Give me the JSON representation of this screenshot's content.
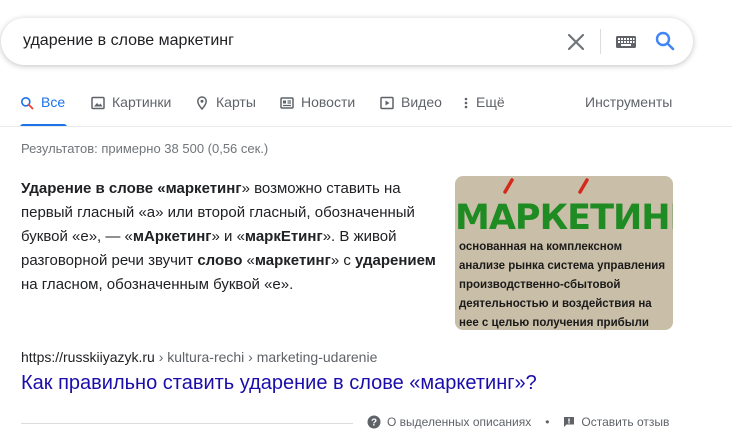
{
  "search": {
    "query": "ударение в слове маркетинг"
  },
  "tabs": [
    {
      "label": "Все",
      "icon": "search-icon",
      "active": true
    },
    {
      "label": "Картинки",
      "icon": "image-icon"
    },
    {
      "label": "Карты",
      "icon": "map-pin-icon"
    },
    {
      "label": "Новости",
      "icon": "news-icon"
    },
    {
      "label": "Видео",
      "icon": "video-icon"
    },
    {
      "label": "Ещё",
      "icon": "more-vert-icon"
    }
  ],
  "tools_label": "Инструменты",
  "stats": "Результатов: примерно 38 500 (0,56 сек.)",
  "snippet": {
    "s1": "Ударение в слове «",
    "s2": "маркетинг",
    "s3": "» возможно ставить на первый гласный «а» или второй гласный, обозначенный буквой «е», — «",
    "s4": "мАркетинг",
    "s5": "» и «",
    "s6": "маркЕтинг",
    "s7": "». В живой разговорной речи звучит ",
    "s8": "слово",
    "s9": " «",
    "s10": "маркетинг",
    "s11": "» с ",
    "s12": "ударением",
    "s13": " на гласном, обозначенным буквой «е»."
  },
  "thumbnail": {
    "title": "МАРКЕТИНГ",
    "text": "основанная на комплексном анализе рынка система управления производственно-сбытовой деятельностью и воздействия на нее с целью получения прибыли"
  },
  "result": {
    "domain": "https://russkiiyazyk.ru",
    "path": " › kultura-rechi › marketing-udarenie",
    "title": "Как правильно ставить ударение в слове «маркетинг»?"
  },
  "footer": {
    "about": "О выделенных описаниях",
    "feedback": "Оставить отзыв"
  },
  "colors": {
    "accent": "#1a73e8",
    "link": "#1a0dab",
    "thumb_title": "#1f8b23"
  }
}
